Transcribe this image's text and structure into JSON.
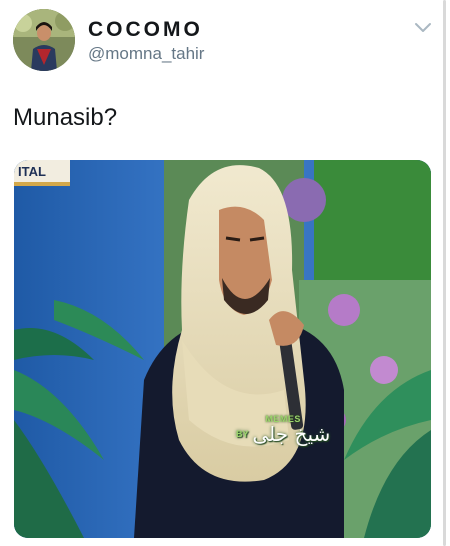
{
  "tweet": {
    "display_name": "COCOMO",
    "handle": "@momna_tahir",
    "text": "Munasib?",
    "menu_icon": "chevron-down-icon"
  },
  "media": {
    "banner_text": "ITAL",
    "watermark": {
      "top": "MEMES",
      "by": "BY",
      "name": "شیخ جلی"
    }
  },
  "colors": {
    "handle": "#657786",
    "text": "#14171a",
    "background": "#ffffff"
  }
}
